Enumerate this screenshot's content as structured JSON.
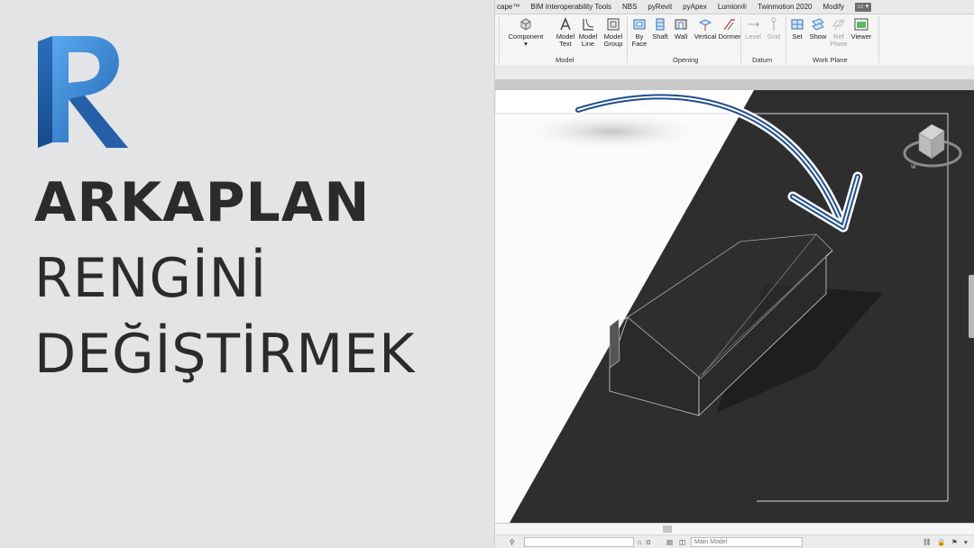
{
  "headline": {
    "line1": "ARKAPLAN",
    "line2": "RENGİNİ",
    "line3": "DEĞİŞTİRMEK"
  },
  "ribbon": {
    "tabs": [
      "cape™",
      "BIM Interoperability Tools",
      "NBS",
      "pyRevit",
      "pyApex",
      "Lumion®",
      "Twinmotion 2020",
      "Modify"
    ],
    "panels": {
      "model": "Model",
      "opening": "Opening",
      "datum": "Datum",
      "workplane": "Work Plane"
    },
    "buttons": {
      "component": "Component",
      "model_text_1": "Model",
      "model_text_2": "Text",
      "model_line_1": "Model",
      "model_line_2": "Line",
      "model_group_1": "Model",
      "model_group_2": "Group",
      "by_face_1": "By",
      "by_face_2": "Face",
      "shaft": "Shaft",
      "wall": "Wall",
      "vertical": "Vertical",
      "dormer": "Dormer",
      "level": "Level",
      "grid": "Grid",
      "set": "Set",
      "show": "Show",
      "ref_plane_1": "Ref",
      "ref_plane_2": "Plane",
      "viewer": "Viewer"
    }
  },
  "statusbar": {
    "zoom_value": ":0",
    "model_select": "Main Model"
  },
  "colors": {
    "revit_blue": "#2f79c8",
    "arrow": "#1f4e8c",
    "view_background": "#2d2d2d",
    "headline": "#2b2b2b"
  },
  "icons": [
    "revit-logo",
    "component-icon",
    "model-text-icon",
    "model-line-icon",
    "model-group-icon",
    "by-face-icon",
    "shaft-icon",
    "wall-opening-icon",
    "vertical-icon",
    "dormer-icon",
    "level-icon",
    "grid-icon",
    "set-icon",
    "show-icon",
    "ref-plane-icon",
    "viewer-icon",
    "viewcube-icon",
    "curved-arrow-icon"
  ]
}
